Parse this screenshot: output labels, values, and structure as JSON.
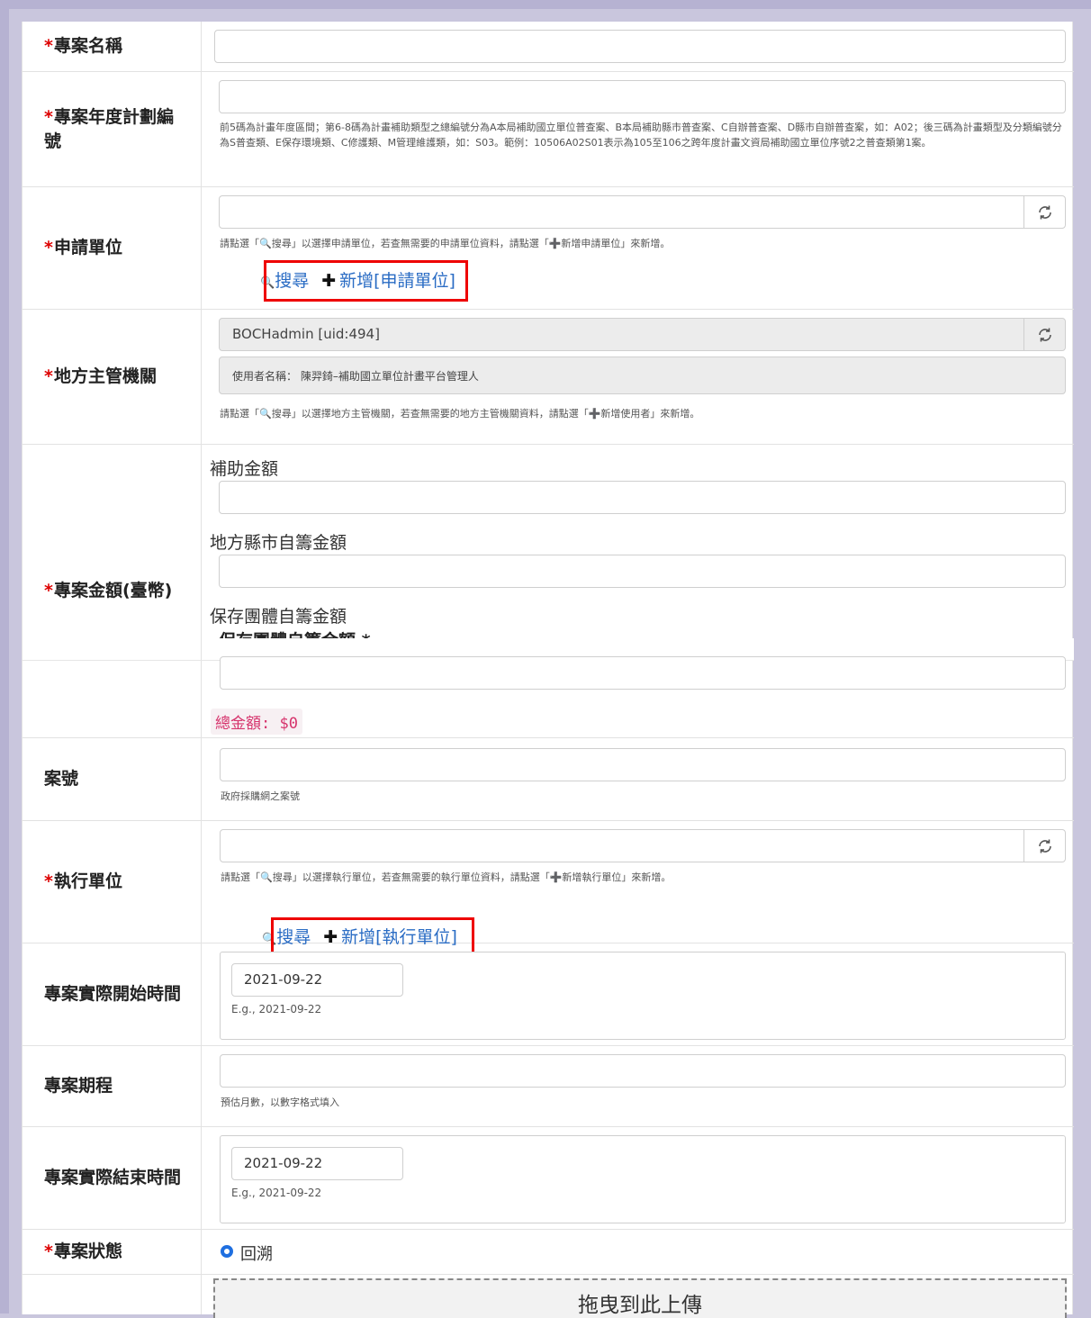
{
  "required_mark": "*",
  "fields": {
    "project_name": {
      "label": "專案名稱"
    },
    "plan_number": {
      "label": "專案年度計劃編號",
      "help": "前5碼為計畫年度區間；第6-8碼為計畫補助類型之總編號分為A本局補助國立單位普查案、B本局補助縣市普查案、C自辦普查案、D縣市自辦普查案，如：A02；後三碼為計畫類型及分類編號分為S普查類、E保存環境類、C修護類、M管理維護類，如：S03。範例：10506A02S01表示為105至106之跨年度計畫文資局補助國立單位序號2之普查類第1案。"
    },
    "applicant": {
      "label": "申請單位",
      "help": "請點選「🔍搜尋」以選擇申請單位，若查無需要的申請單位資料，請點選「➕新增申請單位」來新增。",
      "search_link": "搜尋",
      "add_link": "新增[申請單位]"
    },
    "authority": {
      "label": "地方主管機關",
      "value": "BOCHadmin [uid:494]",
      "username": "使用者名稱： 陳羿錡–補助國立單位計畫平台管理人",
      "help": "請點選「🔍搜尋」以選擇地方主管機關，若查無需要的地方主管機關資料，請點選「➕新增使用者」來新增。"
    },
    "amount": {
      "label": "專案金額(臺幣)",
      "subsidy": "補助金額",
      "county": "地方縣市自籌金額",
      "org": "保存團體自籌金額",
      "org_bold": "保存團體自籌金額 *",
      "total": "總金額: $0"
    },
    "case_no": {
      "label": "案號",
      "help": "政府採購網之案號"
    },
    "executor": {
      "label": "執行單位",
      "help": "請點選「🔍搜尋」以選擇執行單位，若查無需要的執行單位資料，請點選「➕新增執行單位」來新增。",
      "search_link": "搜尋",
      "add_link": "新增[執行單位]"
    },
    "start_date": {
      "label": "專案實際開始時間",
      "value": "2021-09-22",
      "example": "E.g., 2021-09-22"
    },
    "duration": {
      "label": "專案期程",
      "help": "預估月數，以數字格式填入"
    },
    "end_date": {
      "label": "專案實際結束時間",
      "value": "2021-09-22",
      "example": "E.g., 2021-09-22"
    },
    "status": {
      "label": "專案狀態",
      "option": "回溯"
    },
    "upload": {
      "dropzone": "拖曳到此上傳"
    }
  },
  "colors": {
    "accent_link": "#2a6cc4",
    "highlight_box": "#ee0000",
    "required": "#dd0000",
    "total_text": "#d6336c"
  },
  "icons": [
    "search-icon",
    "plus-icon",
    "refresh-icon"
  ]
}
